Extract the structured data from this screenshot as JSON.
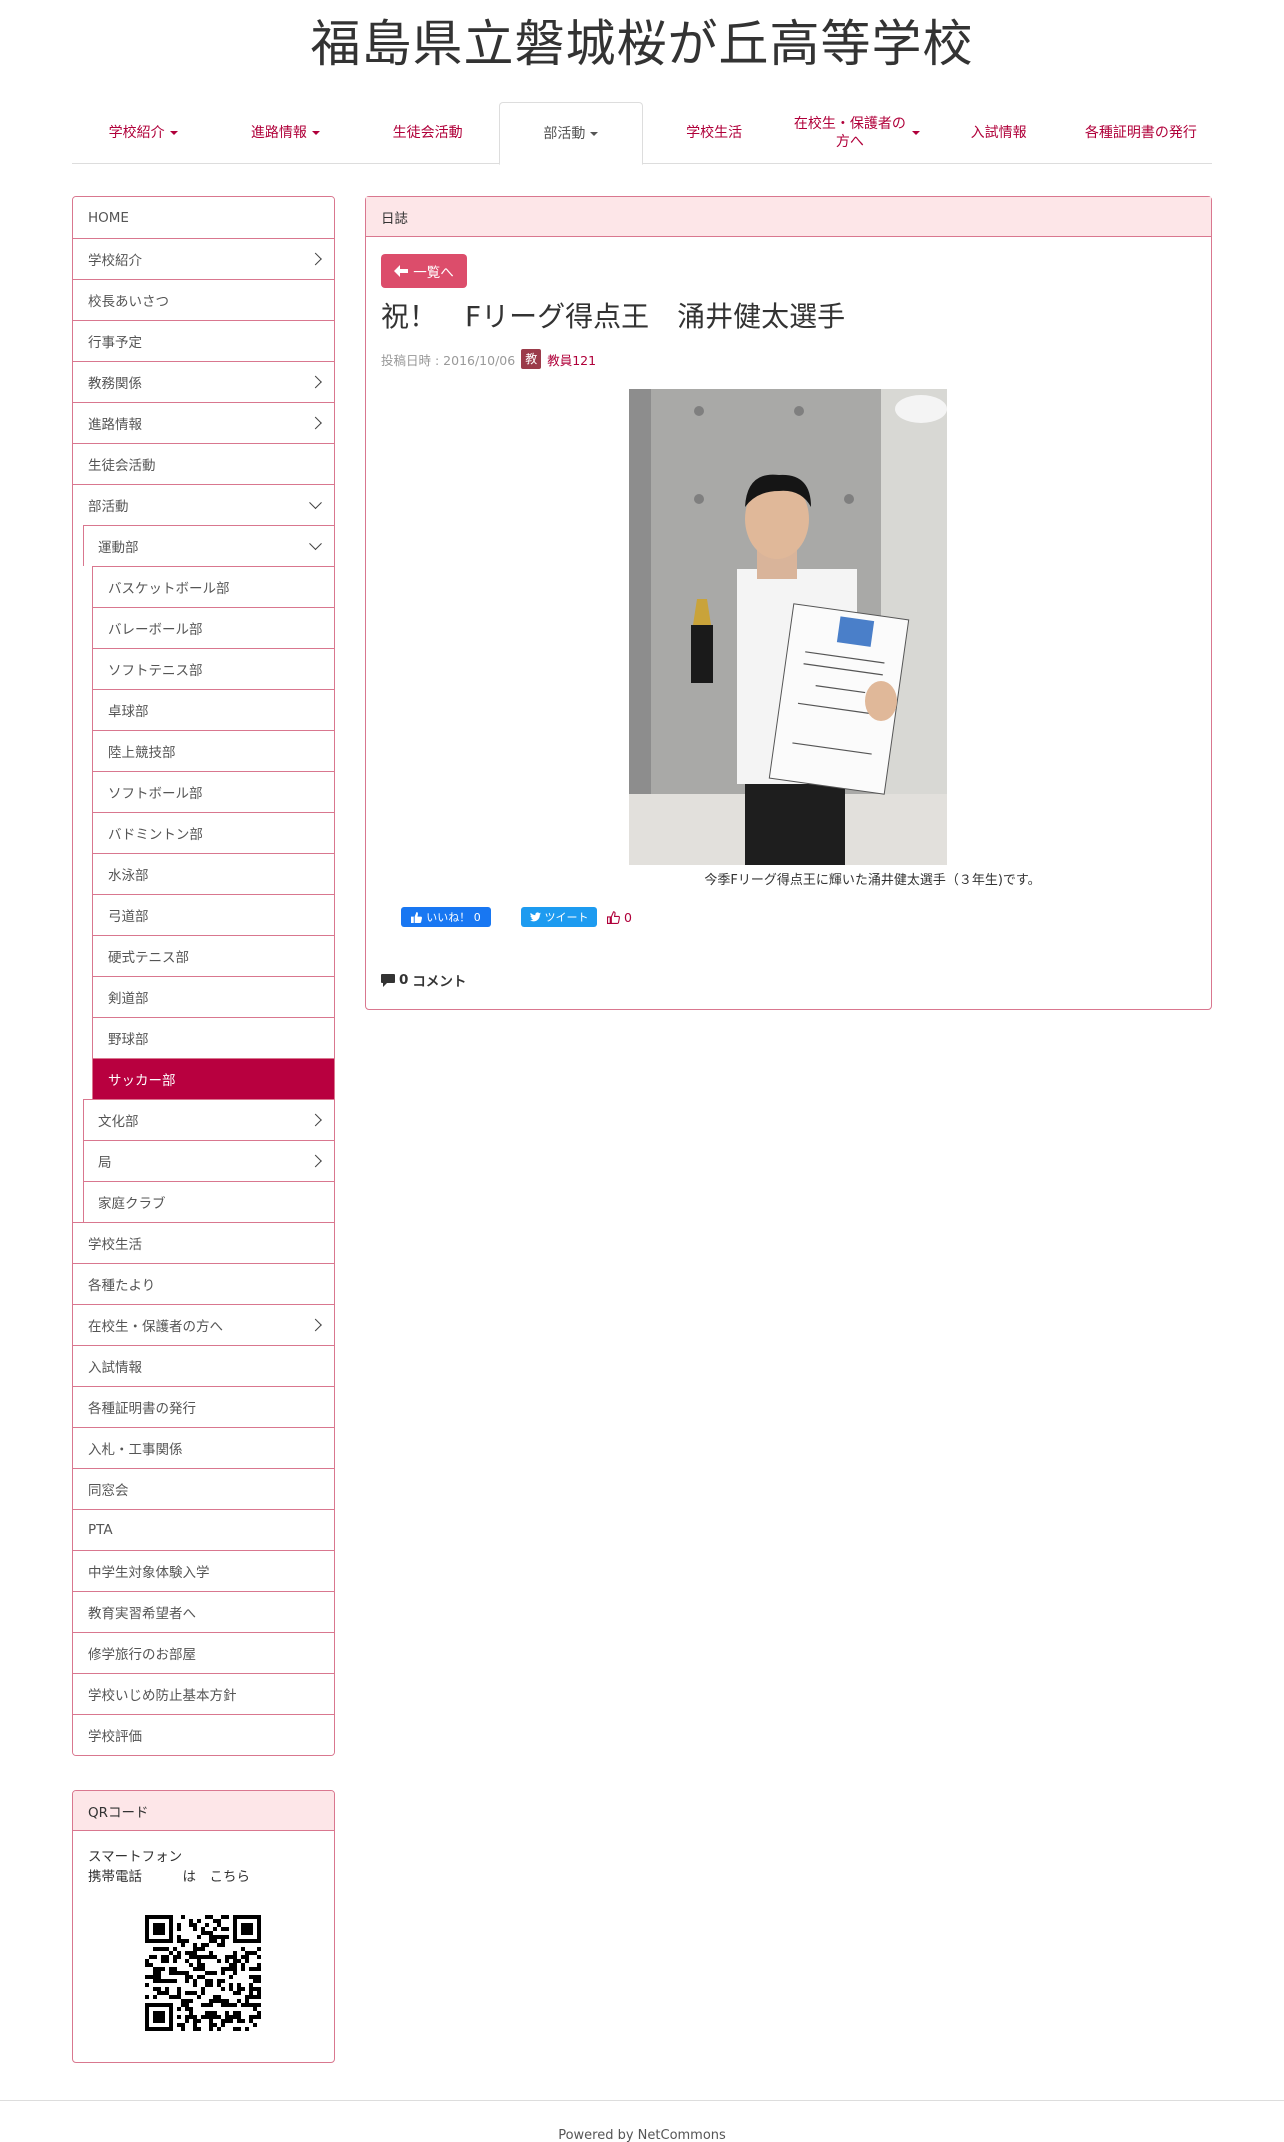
{
  "site": {
    "title": "福島県立磐城桜が丘高等学校"
  },
  "topnav": [
    {
      "label": "学校紹介",
      "dropdown": true
    },
    {
      "label": "進路情報",
      "dropdown": true
    },
    {
      "label": "生徒会活動",
      "dropdown": false
    },
    {
      "label": "部活動",
      "dropdown": true,
      "active": true
    },
    {
      "label": "学校生活",
      "dropdown": false
    },
    {
      "label": "在校生・保護者の方へ",
      "dropdown": true
    },
    {
      "label": "入試情報",
      "dropdown": false
    },
    {
      "label": "各種証明書の発行",
      "dropdown": false
    }
  ],
  "sidebar": {
    "items": [
      {
        "label": "HOME",
        "level": 1
      },
      {
        "label": "学校紹介",
        "level": 1,
        "chevron": "right"
      },
      {
        "label": "校長あいさつ",
        "level": 1
      },
      {
        "label": "行事予定",
        "level": 1
      },
      {
        "label": "教務関係",
        "level": 1,
        "chevron": "right"
      },
      {
        "label": "進路情報",
        "level": 1,
        "chevron": "right"
      },
      {
        "label": "生徒会活動",
        "level": 1
      },
      {
        "label": "部活動",
        "level": 1,
        "chevron": "down"
      },
      {
        "label": "運動部",
        "level": 2,
        "chevron": "down"
      },
      {
        "label": "バスケットボール部",
        "level": 3
      },
      {
        "label": "バレーボール部",
        "level": 3
      },
      {
        "label": "ソフトテニス部",
        "level": 3
      },
      {
        "label": "卓球部",
        "level": 3
      },
      {
        "label": "陸上競技部",
        "level": 3
      },
      {
        "label": "ソフトボール部",
        "level": 3
      },
      {
        "label": "バドミントン部",
        "level": 3
      },
      {
        "label": "水泳部",
        "level": 3
      },
      {
        "label": "弓道部",
        "level": 3
      },
      {
        "label": "硬式テニス部",
        "level": 3
      },
      {
        "label": "剣道部",
        "level": 3
      },
      {
        "label": "野球部",
        "level": 3
      },
      {
        "label": "サッカー部",
        "level": 3,
        "current": true
      },
      {
        "label": "文化部",
        "level": 2,
        "chevron": "right"
      },
      {
        "label": "局",
        "level": 2,
        "chevron": "right"
      },
      {
        "label": "家庭クラブ",
        "level": 2
      },
      {
        "label": "学校生活",
        "level": 1
      },
      {
        "label": "各種たより",
        "level": 1
      },
      {
        "label": "在校生・保護者の方へ",
        "level": 1,
        "chevron": "right"
      },
      {
        "label": "入試情報",
        "level": 1
      },
      {
        "label": "各種証明書の発行",
        "level": 1
      },
      {
        "label": "入札・工事関係",
        "level": 1
      },
      {
        "label": "同窓会",
        "level": 1
      },
      {
        "label": "PTA",
        "level": 1
      },
      {
        "label": "中学生対象体験入学",
        "level": 1
      },
      {
        "label": "教育実習希望者へ",
        "level": 1
      },
      {
        "label": "修学旅行のお部屋",
        "level": 1
      },
      {
        "label": "学校いじめ防止基本方針",
        "level": 1
      },
      {
        "label": "学校評価",
        "level": 1
      }
    ]
  },
  "qr": {
    "heading": "QRコード",
    "line1": "スマートフォン",
    "line2": "携帯電話　　　は　こちら"
  },
  "post": {
    "panel_heading": "日誌",
    "back_label": "一覧へ",
    "title": "祝！　Fリーグ得点王　涌井健太選手",
    "meta_prefix": "投稿日時 : 2016/10/06",
    "avatar_char": "教",
    "author": "教員121",
    "caption": "今季Fリーグ得点王に輝いた涌井健太選手（３年生)です。",
    "fb_label": "いいね！ 0",
    "tw_label": "ツイート",
    "like_count": "0",
    "comments_count": "0",
    "comments_label": "コメント"
  },
  "footer": {
    "text": "Powered by NetCommons"
  },
  "colors": {
    "accent": "#b0003a",
    "border": "#d9778f",
    "panel_head": "#fde6e8",
    "button": "#dc4d6b"
  }
}
